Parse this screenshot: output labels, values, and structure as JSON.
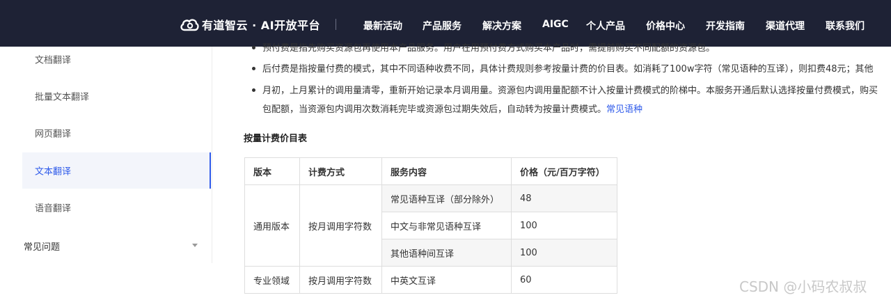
{
  "brand": {
    "name": "有道智云 · AI开放平台",
    "logo_icon": "youdao-cloud-logo-icon"
  },
  "nav": {
    "items": [
      "最新活动",
      "产品服务",
      "解决方案",
      "AIGC",
      "个人产品",
      "价格中心",
      "开发指南",
      "渠道代理",
      "联系我们"
    ]
  },
  "sidebar": {
    "items": [
      {
        "label": "文档翻译",
        "active": false
      },
      {
        "label": "批量文本翻译",
        "active": false
      },
      {
        "label": "网页翻译",
        "active": false
      },
      {
        "label": "文本翻译",
        "active": true
      },
      {
        "label": "语音翻译",
        "active": false
      }
    ],
    "group": {
      "label": "常见问题",
      "icon": "caret-down-icon"
    }
  },
  "content": {
    "bullets": [
      {
        "text": "预付费是指先购买资源包再使用本产品服务。用户在用预付费方式购买本产品时，需提前购买不同配额的资源包。"
      },
      {
        "text": "后付费是指按量付费的模式，其中不同语种收费不同，具体计费规则参考按量计费的价目表。如消耗了100w字符（常见语种的互译），则扣费48元；其他"
      },
      {
        "text": "月初，上月累计的调用量清零，重新开始记录本月调用量。资源包内调用量配额不计入按量计费模式的阶梯中。本服务开通后默认选择按量付费模式，购买",
        "continuation": "包配额，当资源包内调用次数消耗完毕或资源包过期失效后，自动转为按量计费模式。",
        "link": "常见语种"
      }
    ],
    "section_title": "按量计费价目表",
    "table": {
      "headers": [
        "版本",
        "计费方式",
        "服务内容",
        "价格（元/百万字符）"
      ],
      "groups": [
        {
          "version": "通用版本",
          "billing": "按月调用字符数",
          "rows": [
            {
              "service": "常见语种互译（部分除外）",
              "price": "48"
            },
            {
              "service": "中文与非常见语种互译",
              "price": "100"
            },
            {
              "service": "其他语种间互译",
              "price": "100"
            }
          ]
        },
        {
          "version": "专业领域",
          "billing": "按月调用字符数",
          "rows": [
            {
              "service": "中英文互译",
              "price": "60"
            }
          ]
        }
      ]
    }
  },
  "watermark": "CSDN @小码农叔叔",
  "colors": {
    "topbar": "#1e2235",
    "accent": "#2f5bea",
    "shade": "#f6f6f6"
  }
}
